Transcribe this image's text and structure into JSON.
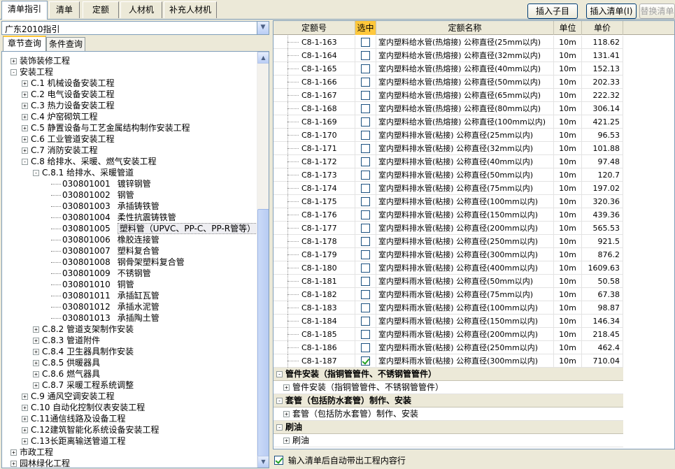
{
  "top_tabs": [
    "清单指引",
    "清单",
    "定额",
    "人材机",
    "补充人材机"
  ],
  "top_buttons": {
    "insert_child": "插入子目",
    "insert_list": "插入清单(I)",
    "replace_list": "替换清单"
  },
  "region": {
    "selected": "广东2010指引"
  },
  "sub_tabs": [
    "章节查询",
    "条件查询"
  ],
  "tree": [
    {
      "indent": 0,
      "box": "+",
      "text": "装饰装修工程"
    },
    {
      "indent": 0,
      "box": "-",
      "text": "安装工程"
    },
    {
      "indent": 1,
      "box": "+",
      "text": "C.1 机械设备安装工程"
    },
    {
      "indent": 1,
      "box": "+",
      "text": "C.2 电气设备安装工程"
    },
    {
      "indent": 1,
      "box": "+",
      "text": "C.3 热力设备安装工程"
    },
    {
      "indent": 1,
      "box": "+",
      "text": "C.4 炉窑砌筑工程"
    },
    {
      "indent": 1,
      "box": "+",
      "text": "C.5 静置设备与工艺金属结构制作安装工程"
    },
    {
      "indent": 1,
      "box": "+",
      "text": "C.6 工业管道安装工程"
    },
    {
      "indent": 1,
      "box": "+",
      "text": "C.7 消防安装工程"
    },
    {
      "indent": 1,
      "box": "-",
      "text": "C.8 给排水、采暖、燃气安装工程"
    },
    {
      "indent": 2,
      "box": "-",
      "text": "C.8.1 给排水、采暖管道"
    },
    {
      "indent": 3,
      "code": "030801001",
      "text": "镀锌钢管"
    },
    {
      "indent": 3,
      "code": "030801002",
      "text": "钢管"
    },
    {
      "indent": 3,
      "code": "030801003",
      "text": "承插铸铁管"
    },
    {
      "indent": 3,
      "code": "030801004",
      "text": "柔性抗震铸铁管"
    },
    {
      "indent": 3,
      "code": "030801005",
      "text": "塑料管（UPVC、PP-C、PP-R管等）",
      "selected": true
    },
    {
      "indent": 3,
      "code": "030801006",
      "text": "橡胶连接管"
    },
    {
      "indent": 3,
      "code": "030801007",
      "text": "塑料复合管"
    },
    {
      "indent": 3,
      "code": "030801008",
      "text": "钢骨架塑料复合管"
    },
    {
      "indent": 3,
      "code": "030801009",
      "text": "不锈钢管"
    },
    {
      "indent": 3,
      "code": "030801010",
      "text": "铜管"
    },
    {
      "indent": 3,
      "code": "030801011",
      "text": "承插缸瓦管"
    },
    {
      "indent": 3,
      "code": "030801012",
      "text": "承插水泥管"
    },
    {
      "indent": 3,
      "code": "030801013",
      "text": "承插陶土管"
    },
    {
      "indent": 2,
      "box": "+",
      "text": "C.8.2 管道支架制作安装"
    },
    {
      "indent": 2,
      "box": "+",
      "text": "C.8.3 管道附件"
    },
    {
      "indent": 2,
      "box": "+",
      "text": "C.8.4 卫生器具制作安装"
    },
    {
      "indent": 2,
      "box": "+",
      "text": "C.8.5 供暖器具"
    },
    {
      "indent": 2,
      "box": "+",
      "text": "C.8.6 燃气器具"
    },
    {
      "indent": 2,
      "box": "+",
      "text": "C.8.7 采暖工程系统调整"
    },
    {
      "indent": 1,
      "box": "+",
      "text": "C.9 通风空调安装工程"
    },
    {
      "indent": 1,
      "box": "+",
      "text": "C.10 自动化控制仪表安装工程"
    },
    {
      "indent": 1,
      "box": "+",
      "text": "C.11通信线路及设备工程"
    },
    {
      "indent": 1,
      "box": "+",
      "text": "C.12建筑智能化系统设备安装工程"
    },
    {
      "indent": 1,
      "box": "+",
      "text": "C.13长距离输送管道工程"
    },
    {
      "indent": 0,
      "box": "+",
      "text": "市政工程"
    },
    {
      "indent": 0,
      "box": "+",
      "text": "园林绿化工程"
    }
  ],
  "grid_headers": [
    "定额号",
    "选中",
    "定额名称",
    "单位",
    "单价"
  ],
  "rows": [
    {
      "code": "C8-1-163",
      "checked": false,
      "name": "室内塑料给水管(热熔接) 公称直径(25mm以内)",
      "unit": "10m",
      "price": "118.62"
    },
    {
      "code": "C8-1-164",
      "checked": false,
      "name": "室内塑料给水管(热熔接) 公称直径(32mm以内)",
      "unit": "10m",
      "price": "131.41"
    },
    {
      "code": "C8-1-165",
      "checked": false,
      "name": "室内塑料给水管(热熔接) 公称直径(40mm以内)",
      "unit": "10m",
      "price": "152.13"
    },
    {
      "code": "C8-1-166",
      "checked": false,
      "name": "室内塑料给水管(热熔接) 公称直径(50mm以内)",
      "unit": "10m",
      "price": "202.33"
    },
    {
      "code": "C8-1-167",
      "checked": false,
      "name": "室内塑料给水管(热熔接) 公称直径(65mm以内)",
      "unit": "10m",
      "price": "222.32"
    },
    {
      "code": "C8-1-168",
      "checked": false,
      "name": "室内塑料给水管(热熔接) 公称直径(80mm以内)",
      "unit": "10m",
      "price": "306.14"
    },
    {
      "code": "C8-1-169",
      "checked": false,
      "name": "室内塑料给水管(热熔接) 公称直径(100mm以内)",
      "unit": "10m",
      "price": "421.25"
    },
    {
      "code": "C8-1-170",
      "checked": false,
      "name": "室内塑料排水管(粘接) 公称直径(25mm以内)",
      "unit": "10m",
      "price": "96.53"
    },
    {
      "code": "C8-1-171",
      "checked": false,
      "name": "室内塑料排水管(粘接) 公称直径(32mm以内)",
      "unit": "10m",
      "price": "101.88"
    },
    {
      "code": "C8-1-172",
      "checked": false,
      "name": "室内塑料排水管(粘接) 公称直径(40mm以内)",
      "unit": "10m",
      "price": "97.48"
    },
    {
      "code": "C8-1-173",
      "checked": false,
      "name": "室内塑料排水管(粘接) 公称直径(50mm以内)",
      "unit": "10m",
      "price": "120.7"
    },
    {
      "code": "C8-1-174",
      "checked": false,
      "name": "室内塑料排水管(粘接) 公称直径(75mm以内)",
      "unit": "10m",
      "price": "197.02"
    },
    {
      "code": "C8-1-175",
      "checked": false,
      "name": "室内塑料排水管(粘接) 公称直径(100mm以内)",
      "unit": "10m",
      "price": "320.36"
    },
    {
      "code": "C8-1-176",
      "checked": false,
      "name": "室内塑料排水管(粘接) 公称直径(150mm以内)",
      "unit": "10m",
      "price": "439.36"
    },
    {
      "code": "C8-1-177",
      "checked": false,
      "name": "室内塑料排水管(粘接) 公称直径(200mm以内)",
      "unit": "10m",
      "price": "565.53"
    },
    {
      "code": "C8-1-178",
      "checked": false,
      "name": "室内塑料排水管(粘接) 公称直径(250mm以内)",
      "unit": "10m",
      "price": "921.5"
    },
    {
      "code": "C8-1-179",
      "checked": false,
      "name": "室内塑料排水管(粘接) 公称直径(300mm以内)",
      "unit": "10m",
      "price": "876.2"
    },
    {
      "code": "C8-1-180",
      "checked": false,
      "name": "室内塑料排水管(粘接) 公称直径(400mm以内)",
      "unit": "10m",
      "price": "1609.63"
    },
    {
      "code": "C8-1-181",
      "checked": false,
      "name": "室内塑料雨水管(粘接) 公称直径(50mm以内)",
      "unit": "10m",
      "price": "50.58"
    },
    {
      "code": "C8-1-182",
      "checked": false,
      "name": "室内塑料雨水管(粘接) 公称直径(75mm以内)",
      "unit": "10m",
      "price": "67.38"
    },
    {
      "code": "C8-1-183",
      "checked": false,
      "name": "室内塑料雨水管(粘接) 公称直径(100mm以内)",
      "unit": "10m",
      "price": "98.87"
    },
    {
      "code": "C8-1-184",
      "checked": false,
      "name": "室内塑料雨水管(粘接) 公称直径(150mm以内)",
      "unit": "10m",
      "price": "146.34"
    },
    {
      "code": "C8-1-185",
      "checked": false,
      "name": "室内塑料雨水管(粘接) 公称直径(200mm以内)",
      "unit": "10m",
      "price": "218.45"
    },
    {
      "code": "C8-1-186",
      "checked": false,
      "name": "室内塑料雨水管(粘接) 公称直径(250mm以内)",
      "unit": "10m",
      "price": "462.4"
    },
    {
      "code": "C8-1-187",
      "checked": true,
      "name": "室内塑料雨水管(粘接) 公称直径(300mm以内)",
      "unit": "10m",
      "price": "710.04"
    }
  ],
  "groups": [
    {
      "title": "管件安装（指铜管管件、不锈钢管管件）",
      "child": "管件安装（指铜管管件、不锈钢管管件）"
    },
    {
      "title": "套管（包括防水套管）制作、安装",
      "child": "套管（包括防水套管）制作、安装"
    },
    {
      "title": "刷油",
      "child": "刷油"
    }
  ],
  "bottom": {
    "auto_bring_label": "输入清单后自动带出工程内容行",
    "checked": true
  }
}
